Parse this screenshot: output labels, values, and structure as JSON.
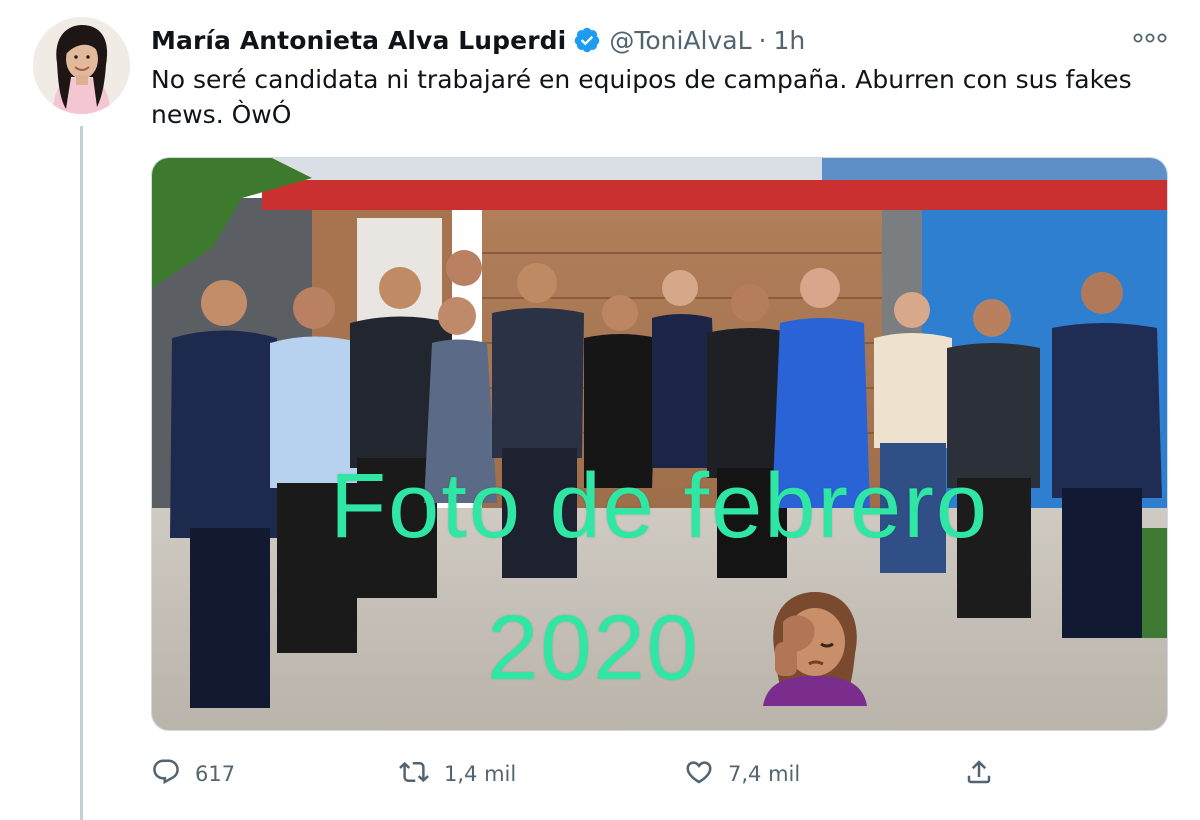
{
  "tweet": {
    "display_name": "María Antonieta Alva Luperdi",
    "handle": "@ToniAlvaL",
    "separator": "·",
    "time": "1h",
    "text": "No seré candidata ni trabajaré en equipos de campaña. Aburren con sus fakes news. ÒwÓ",
    "verified": true,
    "icons": {
      "verified": "verified-badge-icon",
      "more": "more-horizontal-icon",
      "reply": "reply-icon",
      "retweet": "retweet-icon",
      "like": "heart-icon",
      "share": "share-icon"
    }
  },
  "media": {
    "overlay_line1": "Foto de febrero",
    "overlay_line2": "2020",
    "overlay_emoji": "facepalm-emoji",
    "overlay_color": "#2fe6a4"
  },
  "actions": {
    "replies": "617",
    "retweets": "1,4 mil",
    "likes": "7,4 mil"
  },
  "colors": {
    "text": "#0f1419",
    "secondary": "#536471",
    "verified": "#1d9bf0",
    "thread_line": "#c4cfd6"
  }
}
